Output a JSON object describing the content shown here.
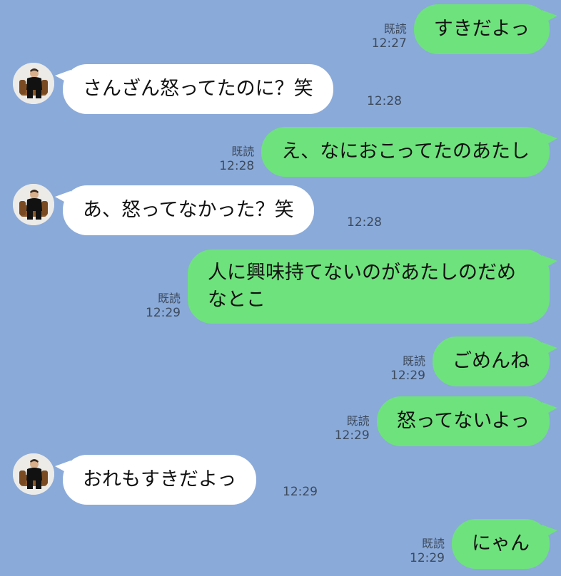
{
  "chat": {
    "colors": {
      "background": "#8aaad9",
      "sent_bubble": "#6ee27c",
      "received_bubble": "#ffffff"
    },
    "messages": [
      {
        "direction": "sent",
        "text": "すきだよっ",
        "read": "既読",
        "time": "12:27"
      },
      {
        "direction": "received",
        "text": "さんざん怒ってたのに？笑",
        "time": "12:28"
      },
      {
        "direction": "sent",
        "text": "え、なにおこってたのあたし",
        "read": "既読",
        "time": "12:28"
      },
      {
        "direction": "received",
        "text": "あ、怒ってなかった？笑",
        "time": "12:28"
      },
      {
        "direction": "sent",
        "text": "人に興味持てないのがあたしのだめなとこ",
        "read": "既読",
        "time": "12:29"
      },
      {
        "direction": "sent",
        "text": "ごめんね",
        "read": "既読",
        "time": "12:29"
      },
      {
        "direction": "sent",
        "text": "怒ってないよっ",
        "read": "既読",
        "time": "12:29"
      },
      {
        "direction": "received",
        "text": "おれもすきだよっ",
        "time": "12:29"
      },
      {
        "direction": "sent",
        "text": "にゃん",
        "read": "既読",
        "time": "12:29"
      }
    ]
  }
}
